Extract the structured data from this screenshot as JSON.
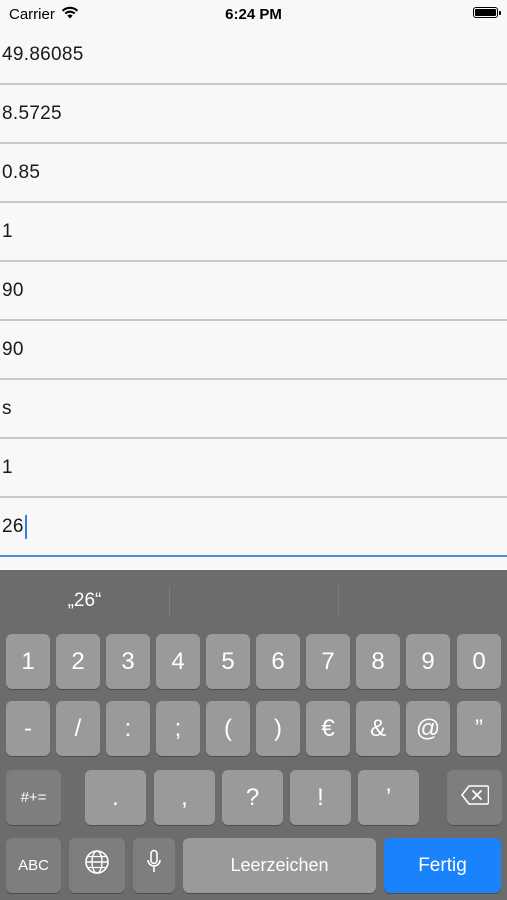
{
  "status_bar": {
    "carrier": "Carrier",
    "time": "6:24 PM"
  },
  "fields": [
    "49.86085",
    "8.5725",
    "0.85",
    "1",
    "90",
    "90",
    "s",
    "1",
    "26"
  ],
  "keyboard": {
    "suggestion": "„26“",
    "row1": [
      "1",
      "2",
      "3",
      "4",
      "5",
      "6",
      "7",
      "8",
      "9",
      "0"
    ],
    "row2": [
      "-",
      "/",
      ":",
      ";",
      "(",
      ")",
      "€",
      "&",
      "@",
      "”"
    ],
    "row3_toggle": "#+=",
    "row3": [
      ".",
      ",",
      "?",
      "!",
      "’"
    ],
    "abc": "ABC",
    "space": "Leerzeichen",
    "return": "Fertig"
  },
  "colors": {
    "accent": "#1a82fb",
    "keyboard_bg": "#6c6c6c",
    "key": "#9a9a9a"
  }
}
